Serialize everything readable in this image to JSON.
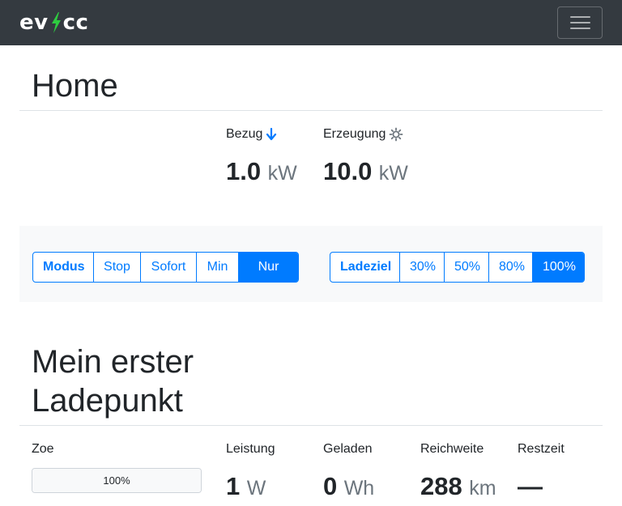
{
  "brand": {
    "left": "ev",
    "right": "cc"
  },
  "colors": {
    "accent": "#007bff",
    "navbar": "#343a40",
    "bolt": "#2ecc40"
  },
  "home": {
    "title": "Home",
    "grid": {
      "label": "Bezug",
      "icon": "arrow-down-icon",
      "value": "1.0",
      "unit": "kW"
    },
    "pv": {
      "label": "Erzeugung",
      "icon": "sun-icon",
      "value": "10.0",
      "unit": "kW"
    }
  },
  "controls": {
    "mode": {
      "label": "Modus",
      "options": [
        "Stop",
        "Sofort",
        "Min",
        "Nur PV"
      ],
      "selected": "Nur PV"
    },
    "target": {
      "label": "Ladeziel",
      "options": [
        "30%",
        "50%",
        "80%",
        "100%"
      ],
      "selected": "100%"
    }
  },
  "loadpoint": {
    "title_line1": "Mein erster",
    "title_line2": "Ladepunkt",
    "vehicle": {
      "label": "Zoe",
      "soc_text": "100%",
      "soc_fraction": 1.0
    },
    "power": {
      "label": "Leistung",
      "value": "1",
      "unit": "W"
    },
    "charged": {
      "label": "Geladen",
      "value": "0",
      "unit": "Wh"
    },
    "range": {
      "label": "Reichweite",
      "value": "288",
      "unit": "km"
    },
    "remaining": {
      "label": "Restzeit",
      "value": "—"
    }
  }
}
